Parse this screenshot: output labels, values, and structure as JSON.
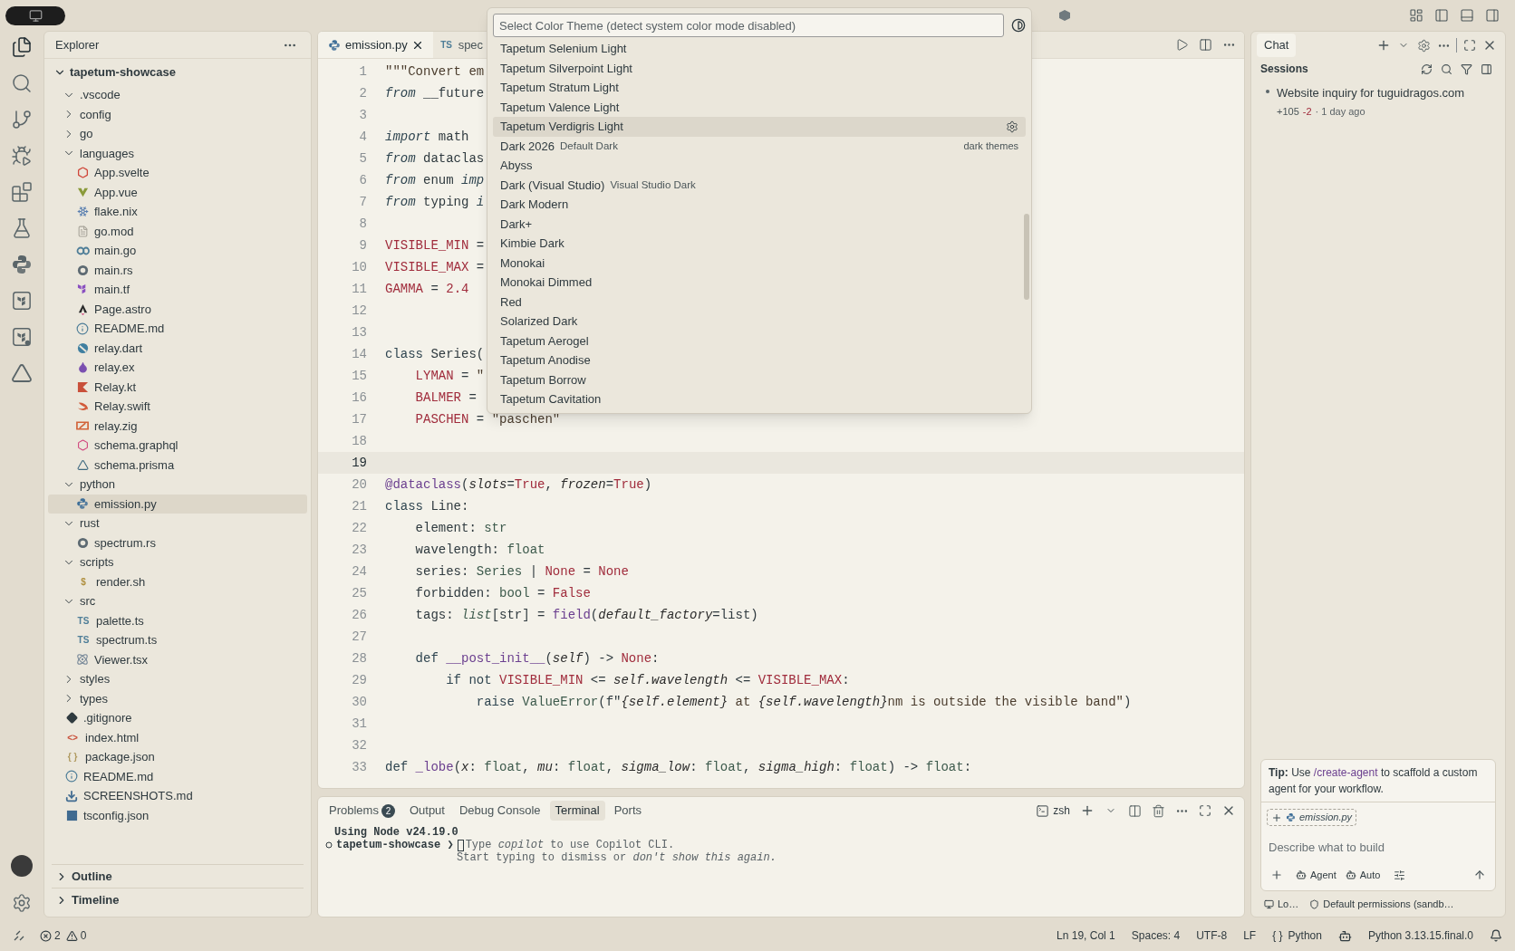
{
  "activity_bar": {
    "items": [
      {
        "kind": "files",
        "selected": true
      },
      {
        "kind": "search",
        "selected": false
      },
      {
        "kind": "git",
        "selected": false
      },
      {
        "kind": "debug",
        "selected": false
      },
      {
        "kind": "extensions",
        "selected": false
      },
      {
        "kind": "testing",
        "selected": false
      },
      {
        "kind": "python",
        "selected": false
      },
      {
        "kind": "terraform",
        "selected": false
      },
      {
        "kind": "terraform-cloud",
        "selected": false
      },
      {
        "kind": "prism",
        "selected": false
      }
    ]
  },
  "explorer": {
    "title": "Explorer",
    "root": {
      "name": "tapetum-showcase",
      "expanded": true
    },
    "items": [
      {
        "name": ".vscode",
        "kind": "folder",
        "expanded": true,
        "selected": false
      },
      {
        "name": "config",
        "kind": "folder",
        "expanded": false,
        "selected": false
      },
      {
        "name": "go",
        "kind": "folder",
        "expanded": false,
        "selected": false
      },
      {
        "name": "languages",
        "kind": "folder",
        "expanded": true,
        "selected": false,
        "children": [
          {
            "name": "App.svelte",
            "kind": "svelte",
            "selected": false
          },
          {
            "name": "App.vue",
            "kind": "vue",
            "selected": false
          },
          {
            "name": "flake.nix",
            "kind": "nix",
            "selected": false
          },
          {
            "name": "go.mod",
            "kind": "text",
            "selected": false
          },
          {
            "name": "main.go",
            "kind": "go",
            "selected": false
          },
          {
            "name": "main.rs",
            "kind": "rust",
            "selected": false
          },
          {
            "name": "main.tf",
            "kind": "terraform",
            "selected": false
          },
          {
            "name": "Page.astro",
            "kind": "astro",
            "selected": false
          },
          {
            "name": "README.md",
            "kind": "info",
            "selected": false
          },
          {
            "name": "relay.dart",
            "kind": "dart",
            "selected": false
          },
          {
            "name": "relay.ex",
            "kind": "elixir",
            "selected": false
          },
          {
            "name": "Relay.kt",
            "kind": "kotlin",
            "selected": false
          },
          {
            "name": "Relay.swift",
            "kind": "swift",
            "selected": false
          },
          {
            "name": "relay.zig",
            "kind": "zig",
            "selected": false
          },
          {
            "name": "schema.graphql",
            "kind": "graphql",
            "selected": false
          },
          {
            "name": "schema.prisma",
            "kind": "prisma",
            "selected": false
          }
        ]
      },
      {
        "name": "python",
        "kind": "folder",
        "expanded": true,
        "selected": false,
        "children": [
          {
            "name": "emission.py",
            "kind": "python",
            "selected": true
          }
        ]
      },
      {
        "name": "rust",
        "kind": "folder",
        "expanded": true,
        "selected": false,
        "children": [
          {
            "name": "spectrum.rs",
            "kind": "rust",
            "selected": false
          }
        ]
      },
      {
        "name": "scripts",
        "kind": "folder",
        "expanded": true,
        "selected": false,
        "children": [
          {
            "name": "render.sh",
            "kind": "glyph",
            "glyph": "$",
            "selected": false
          }
        ]
      },
      {
        "name": "src",
        "kind": "folder",
        "expanded": true,
        "selected": false,
        "children": [
          {
            "name": "palette.ts",
            "kind": "glyph",
            "glyph": "TS",
            "selected": false
          },
          {
            "name": "spectrum.ts",
            "kind": "glyph",
            "glyph": "TS",
            "selected": false
          },
          {
            "name": "Viewer.tsx",
            "kind": "react",
            "selected": false
          }
        ]
      },
      {
        "name": "styles",
        "kind": "folder",
        "expanded": false,
        "selected": false
      },
      {
        "name": "types",
        "kind": "folder",
        "expanded": false,
        "selected": false
      },
      {
        "name": ".gitignore",
        "kind": "git",
        "selected": false
      },
      {
        "name": "index.html",
        "kind": "glyph",
        "glyph": "<>",
        "selected": false
      },
      {
        "name": "package.json",
        "kind": "glyph",
        "glyph": "{ }",
        "selected": false
      },
      {
        "name": "README.md",
        "kind": "info",
        "selected": false
      },
      {
        "name": "SCREENSHOTS.md",
        "kind": "download",
        "selected": false
      },
      {
        "name": "tsconfig.json",
        "kind": "tsconfig",
        "selected": false
      }
    ],
    "sections": [
      {
        "title": "Outline",
        "expanded": false
      },
      {
        "title": "Timeline",
        "expanded": false
      }
    ]
  },
  "editor": {
    "tabs": [
      {
        "label": "emission.py",
        "kind": "python",
        "selected": true
      },
      {
        "label": "spec",
        "kind": "glyph",
        "glyph": "TS",
        "selected": false
      }
    ],
    "lines": [
      {
        "n": "1",
        "current": false,
        "tokens": [
          {
            "kind": "str",
            "text": "\"\"\"Convert em"
          }
        ]
      },
      {
        "n": "2",
        "current": false,
        "tokens": [
          {
            "kind": "kwi",
            "text": "from"
          },
          {
            "kind": "plain",
            "text": " __future"
          }
        ]
      },
      {
        "n": "3",
        "current": false
      },
      {
        "n": "4",
        "current": false,
        "tokens": [
          {
            "kind": "kwi",
            "text": "import"
          },
          {
            "kind": "plain",
            "text": " math"
          }
        ]
      },
      {
        "n": "5",
        "current": false,
        "tokens": [
          {
            "kind": "kwi",
            "text": "from"
          },
          {
            "kind": "plain",
            "text": " dataclas"
          }
        ]
      },
      {
        "n": "6",
        "current": false,
        "tokens": [
          {
            "kind": "kwi",
            "text": "from"
          },
          {
            "kind": "plain",
            "text": " enum "
          },
          {
            "kind": "kwi",
            "text": "imp"
          }
        ]
      },
      {
        "n": "7",
        "current": false,
        "tokens": [
          {
            "kind": "kwi",
            "text": "from"
          },
          {
            "kind": "plain",
            "text": " typing "
          },
          {
            "kind": "kwi",
            "text": "i"
          }
        ]
      },
      {
        "n": "8",
        "current": false
      },
      {
        "n": "9",
        "current": false,
        "tokens": [
          {
            "kind": "const",
            "text": "VISIBLE_MIN"
          },
          {
            "kind": "plain",
            "text": " ="
          }
        ]
      },
      {
        "n": "10",
        "current": false,
        "tokens": [
          {
            "kind": "const",
            "text": "VISIBLE_MAX"
          },
          {
            "kind": "plain",
            "text": " ="
          }
        ]
      },
      {
        "n": "11",
        "current": false,
        "tokens": [
          {
            "kind": "const",
            "text": "GAMMA"
          },
          {
            "kind": "plain",
            "text": " = "
          },
          {
            "kind": "const",
            "text": "2.4"
          }
        ]
      },
      {
        "n": "12",
        "current": false
      },
      {
        "n": "13",
        "current": false
      },
      {
        "n": "14",
        "current": false,
        "tokens": [
          {
            "kind": "kw",
            "text": "class"
          },
          {
            "kind": "plain",
            "text": " Series("
          }
        ]
      },
      {
        "n": "15",
        "current": false,
        "tokens": [
          {
            "kind": "const",
            "text": "    LYMAN"
          },
          {
            "kind": "plain",
            "text": " = "
          },
          {
            "kind": "str",
            "text": "\""
          }
        ]
      },
      {
        "n": "16",
        "current": false,
        "tokens": [
          {
            "kind": "const",
            "text": "    BALMER"
          },
          {
            "kind": "plain",
            "text": " ="
          }
        ]
      },
      {
        "n": "17",
        "current": false,
        "tokens": [
          {
            "kind": "const",
            "text": "    PASCHEN"
          },
          {
            "kind": "plain",
            "text": " = "
          },
          {
            "kind": "str",
            "text": "\"paschen\""
          }
        ]
      },
      {
        "n": "18",
        "current": false
      },
      {
        "n": "19",
        "current": true
      },
      {
        "n": "20",
        "current": false,
        "tokens": [
          {
            "kind": "fn",
            "text": "@dataclass"
          },
          {
            "kind": "plain",
            "text": "("
          },
          {
            "kind": "param",
            "text": "slots"
          },
          {
            "kind": "plain",
            "text": "="
          },
          {
            "kind": "const",
            "text": "True"
          },
          {
            "kind": "plain",
            "text": ", "
          },
          {
            "kind": "param",
            "text": "frozen"
          },
          {
            "kind": "plain",
            "text": "="
          },
          {
            "kind": "const",
            "text": "True"
          },
          {
            "kind": "plain",
            "text": ")"
          }
        ]
      },
      {
        "n": "21",
        "current": false,
        "tokens": [
          {
            "kind": "kw",
            "text": "class"
          },
          {
            "kind": "plain",
            "text": " Line:"
          }
        ]
      },
      {
        "n": "22",
        "current": false,
        "tokens": [
          {
            "kind": "plain",
            "text": "    element: "
          },
          {
            "kind": "type",
            "text": "str"
          }
        ]
      },
      {
        "n": "23",
        "current": false,
        "tokens": [
          {
            "kind": "plain",
            "text": "    wavelength: "
          },
          {
            "kind": "type",
            "text": "float"
          }
        ]
      },
      {
        "n": "24",
        "current": false,
        "tokens": [
          {
            "kind": "plain",
            "text": "    series: "
          },
          {
            "kind": "type",
            "text": "Series"
          },
          {
            "kind": "plain",
            "text": " | "
          },
          {
            "kind": "const",
            "text": "None"
          },
          {
            "kind": "plain",
            "text": " = "
          },
          {
            "kind": "const",
            "text": "None"
          }
        ]
      },
      {
        "n": "25",
        "current": false,
        "tokens": [
          {
            "kind": "plain",
            "text": "    forbidden: "
          },
          {
            "kind": "type",
            "text": "bool"
          },
          {
            "kind": "plain",
            "text": " = "
          },
          {
            "kind": "const",
            "text": "False"
          }
        ]
      },
      {
        "n": "26",
        "current": false,
        "tokens": [
          {
            "kind": "plain",
            "text": "    tags: "
          },
          {
            "kind": "typei",
            "text": "list"
          },
          {
            "kind": "plain",
            "text": "[str] = "
          },
          {
            "kind": "fn",
            "text": "field"
          },
          {
            "kind": "plain",
            "text": "("
          },
          {
            "kind": "param",
            "text": "default_factory"
          },
          {
            "kind": "plain",
            "text": "=list)"
          }
        ]
      },
      {
        "n": "27",
        "current": false
      },
      {
        "n": "28",
        "current": false,
        "tokens": [
          {
            "kind": "kw",
            "text": "    def "
          },
          {
            "kind": "fn",
            "text": "__post_init__"
          },
          {
            "kind": "plain",
            "text": "("
          },
          {
            "kind": "param",
            "text": "self"
          },
          {
            "kind": "plain",
            "text": ") -> "
          },
          {
            "kind": "const",
            "text": "None"
          },
          {
            "kind": "plain",
            "text": ":"
          }
        ]
      },
      {
        "n": "29",
        "current": false,
        "tokens": [
          {
            "kind": "kw",
            "text": "        if not "
          },
          {
            "kind": "const",
            "text": "VISIBLE_MIN"
          },
          {
            "kind": "plain",
            "text": " <= "
          },
          {
            "kind": "param",
            "text": "self.wavelength"
          },
          {
            "kind": "plain",
            "text": " <= "
          },
          {
            "kind": "const",
            "text": "VISIBLE_MAX"
          },
          {
            "kind": "plain",
            "text": ":"
          }
        ]
      },
      {
        "n": "30",
        "current": false,
        "tokens": [
          {
            "kind": "kw",
            "text": "            raise "
          },
          {
            "kind": "type",
            "text": "ValueError"
          },
          {
            "kind": "plain",
            "text": "(f\""
          },
          {
            "kind": "param",
            "text": "{self.element}"
          },
          {
            "kind": "str",
            "text": " at "
          },
          {
            "kind": "param",
            "text": "{self.wavelength}"
          },
          {
            "kind": "str",
            "text": "nm is outside the visible band\""
          },
          {
            "kind": "plain",
            "text": ")"
          }
        ]
      },
      {
        "n": "31",
        "current": false
      },
      {
        "n": "32",
        "current": false
      },
      {
        "n": "33",
        "current": false,
        "tokens": [
          {
            "kind": "kw",
            "text": "def "
          },
          {
            "kind": "fn",
            "text": "_lobe"
          },
          {
            "kind": "plain",
            "text": "("
          },
          {
            "kind": "param",
            "text": "x"
          },
          {
            "kind": "plain",
            "text": ": "
          },
          {
            "kind": "type",
            "text": "float"
          },
          {
            "kind": "plain",
            "text": ", "
          },
          {
            "kind": "param",
            "text": "mu"
          },
          {
            "kind": "plain",
            "text": ": "
          },
          {
            "kind": "type",
            "text": "float"
          },
          {
            "kind": "plain",
            "text": ", "
          },
          {
            "kind": "param",
            "text": "sigma_low"
          },
          {
            "kind": "plain",
            "text": ": "
          },
          {
            "kind": "type",
            "text": "float"
          },
          {
            "kind": "plain",
            "text": ", "
          },
          {
            "kind": "param",
            "text": "sigma_high"
          },
          {
            "kind": "plain",
            "text": ": "
          },
          {
            "kind": "type",
            "text": "float"
          },
          {
            "kind": "plain",
            "text": ") -> "
          },
          {
            "kind": "type",
            "text": "float"
          },
          {
            "kind": "plain",
            "text": ":"
          }
        ]
      }
    ]
  },
  "theme_picker": {
    "placeholder": "Select Color Theme (detect system color mode disabled)",
    "items": [
      {
        "label": "Tapetum Selenium Light",
        "selected": false
      },
      {
        "label": "Tapetum Silverpoint Light",
        "selected": false
      },
      {
        "label": "Tapetum Stratum Light",
        "selected": false
      },
      {
        "label": "Tapetum Valence Light",
        "selected": false
      },
      {
        "label": "Tapetum Verdigris Light",
        "selected": true
      },
      {
        "label": "Dark 2026",
        "detail": "Default Dark",
        "group": "dark themes",
        "selected": false
      },
      {
        "label": "Abyss",
        "selected": false
      },
      {
        "label": "Dark (Visual Studio)",
        "detail": "Visual Studio Dark",
        "selected": false
      },
      {
        "label": "Dark Modern",
        "selected": false
      },
      {
        "label": "Dark+",
        "selected": false
      },
      {
        "label": "Kimbie Dark",
        "selected": false
      },
      {
        "label": "Monokai",
        "selected": false
      },
      {
        "label": "Monokai Dimmed",
        "selected": false
      },
      {
        "label": "Red",
        "selected": false
      },
      {
        "label": "Solarized Dark",
        "selected": false
      },
      {
        "label": "Tapetum Aerogel",
        "selected": false
      },
      {
        "label": "Tapetum Anodise",
        "selected": false
      },
      {
        "label": "Tapetum Borrow",
        "selected": false
      },
      {
        "label": "Tapetum Cavitation",
        "selected": false
      }
    ]
  },
  "panel": {
    "tabs": [
      {
        "label": "Problems",
        "badge": "2",
        "selected": false
      },
      {
        "label": "Output",
        "selected": false
      },
      {
        "label": "Debug Console",
        "selected": false
      },
      {
        "label": "Terminal",
        "selected": true
      },
      {
        "label": "Ports",
        "selected": false
      }
    ],
    "shell": "zsh",
    "terminal": {
      "banner": "Using Node v24.19.0",
      "prompt": "tapetum-showcase ❯",
      "hint_1": "Type *copilot* to use Copilot CLI.",
      "hint_2": "Start typing to dismiss or *don't show this again.*"
    }
  },
  "chat": {
    "title": "Chat",
    "sessions_title": "Sessions",
    "sessions": [
      {
        "title": "Website inquiry for tuguidragos.com",
        "added": "+105",
        "removed": "-2",
        "time": "· 1 day ago"
      }
    ],
    "tip": {
      "label": "Tip:",
      "before": "Use",
      "command": "/create-agent",
      "after": "to scaffold a custom agent for your workflow."
    },
    "attachment": "emission.py",
    "placeholder": "Describe what to build",
    "mode": "Agent",
    "model": "Auto",
    "footer": {
      "location": "Lo…",
      "permissions": "Default permissions (sandb…"
    }
  },
  "status_bar": {
    "errors": "2",
    "warnings": "0",
    "position": "Ln 19, Col 1",
    "spaces": "Spaces: 4",
    "encoding": "UTF-8",
    "eol": "LF",
    "language_glyph": "{ }",
    "language": "Python",
    "interpreter": "Python 3.13.15.final.0"
  }
}
